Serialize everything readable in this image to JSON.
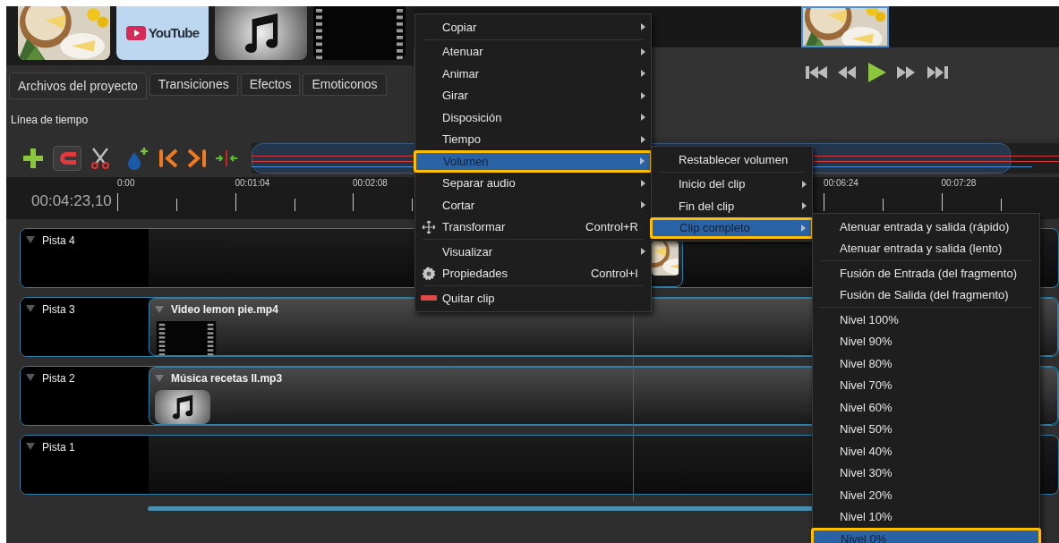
{
  "project_files": [
    {
      "kind": "picture"
    },
    {
      "kind": "logo",
      "text": "YouTube"
    },
    {
      "kind": "audio"
    },
    {
      "kind": "video"
    }
  ],
  "tabs": [
    {
      "label": "Archivos del proyecto",
      "selected": true
    },
    {
      "label": "Transiciones",
      "selected": false
    },
    {
      "label": "Efectos",
      "selected": false
    },
    {
      "label": "Emoticonos",
      "selected": false
    }
  ],
  "timeline": {
    "title": "Línea de tiempo",
    "snapping": {
      "on": true
    },
    "current_time": "00:04:23,10",
    "ruler_labels": [
      "0:00",
      "00:01:04",
      "00:02:08",
      "00:06:24",
      "00:07:28"
    ],
    "zoom": {
      "level": 0.94
    },
    "tracks": [
      {
        "name": "Pista 4",
        "clip": {
          "kind": "tail"
        }
      },
      {
        "name": "Pista 3",
        "clip": {
          "kind": "video",
          "title": "Video lemon pie.mp4"
        }
      },
      {
        "name": "Pista 2",
        "clip": {
          "kind": "audio",
          "title": "Música recetas II.mp3"
        }
      },
      {
        "name": "Pista 1"
      }
    ]
  },
  "context_menu": {
    "items": [
      {
        "kind": "item",
        "label": "Copiar",
        "submenu": true,
        "selected": false
      },
      {
        "kind": "separator"
      },
      {
        "kind": "item",
        "label": "Atenuar",
        "submenu": true,
        "selected": false
      },
      {
        "kind": "item",
        "label": "Animar",
        "submenu": true,
        "selected": false
      },
      {
        "kind": "item",
        "label": "Girar",
        "submenu": true,
        "selected": false
      },
      {
        "kind": "item",
        "label": "Disposición",
        "submenu": true,
        "selected": false
      },
      {
        "kind": "item",
        "label": "Tiempo",
        "submenu": true,
        "selected": false
      },
      {
        "kind": "item",
        "label": "Volumen",
        "submenu": true,
        "selected": true
      },
      {
        "kind": "item",
        "label": "Separar audio",
        "submenu": true,
        "selected": false
      },
      {
        "kind": "item",
        "label": "Cortar",
        "submenu": true,
        "selected": false
      },
      {
        "kind": "item",
        "label": "Transformar",
        "shortcut": "Control+R",
        "submenu": false,
        "selected": false
      },
      {
        "kind": "separator"
      },
      {
        "kind": "item",
        "label": "Visualizar",
        "submenu": true,
        "selected": false
      },
      {
        "kind": "item",
        "label": "Propiedades",
        "shortcut": "Control+I",
        "submenu": false,
        "selected": false
      },
      {
        "kind": "separator"
      },
      {
        "kind": "item",
        "label": "Quitar clip",
        "submenu": false,
        "selected": false
      }
    ]
  },
  "volume_submenu": {
    "items": [
      {
        "kind": "item",
        "label": "Restablecer volumen",
        "submenu": false,
        "selected": false
      },
      {
        "kind": "separator"
      },
      {
        "kind": "item",
        "label": "Inicio del clip",
        "submenu": true,
        "selected": false
      },
      {
        "kind": "item",
        "label": "Fin del clip",
        "submenu": true,
        "selected": false
      },
      {
        "kind": "item",
        "label": "Clip completo",
        "submenu": true,
        "selected": true
      }
    ]
  },
  "clip_submenu": {
    "items": [
      {
        "kind": "item",
        "label": "Atenuar entrada y salida (rápido)",
        "submenu": false,
        "selected": false
      },
      {
        "kind": "item",
        "label": "Atenuar entrada y salida (lento)",
        "submenu": false,
        "selected": false
      },
      {
        "kind": "separator"
      },
      {
        "kind": "item",
        "label": "Fusión de Entrada (del fragmento)",
        "submenu": false,
        "selected": false
      },
      {
        "kind": "item",
        "label": "Fusión de Salida (del fragmento)",
        "submenu": false,
        "selected": false
      },
      {
        "kind": "separator"
      },
      {
        "kind": "item",
        "label": "Nivel 100%",
        "submenu": false,
        "selected": false
      },
      {
        "kind": "item",
        "label": "Nivel 90%",
        "submenu": false,
        "selected": false
      },
      {
        "kind": "item",
        "label": "Nivel 80%",
        "submenu": false,
        "selected": false
      },
      {
        "kind": "item",
        "label": "Nivel 70%",
        "submenu": false,
        "selected": false
      },
      {
        "kind": "item",
        "label": "Nivel 60%",
        "submenu": false,
        "selected": false
      },
      {
        "kind": "item",
        "label": "Nivel 50%",
        "submenu": false,
        "selected": false
      },
      {
        "kind": "item",
        "label": "Nivel 40%",
        "submenu": false,
        "selected": false
      },
      {
        "kind": "item",
        "label": "Nivel 30%",
        "submenu": false,
        "selected": false
      },
      {
        "kind": "item",
        "label": "Nivel 20%",
        "submenu": false,
        "selected": false
      },
      {
        "kind": "item",
        "label": "Nivel 10%",
        "submenu": false,
        "selected": false
      },
      {
        "kind": "item",
        "label": "Nivel 0%",
        "submenu": false,
        "selected": true
      }
    ]
  }
}
